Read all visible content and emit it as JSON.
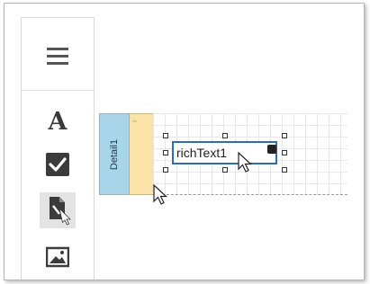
{
  "toolbox": {
    "items": [
      {
        "name": "menu-icon",
        "label": "Menu"
      },
      {
        "name": "label-text-icon",
        "label": "A"
      },
      {
        "name": "checkbox-icon",
        "label": "Check Box"
      },
      {
        "name": "rich-text-icon",
        "label": "Rich Text"
      },
      {
        "name": "picture-icon",
        "label": "Picture Box"
      }
    ]
  },
  "band": {
    "label": "Detail1"
  },
  "control": {
    "text": "richText1"
  },
  "colors": {
    "band": "#a9d5eb",
    "ruler": "#fbe2a8",
    "selection": "#2d6db5",
    "icon": "#3b3b3b"
  }
}
